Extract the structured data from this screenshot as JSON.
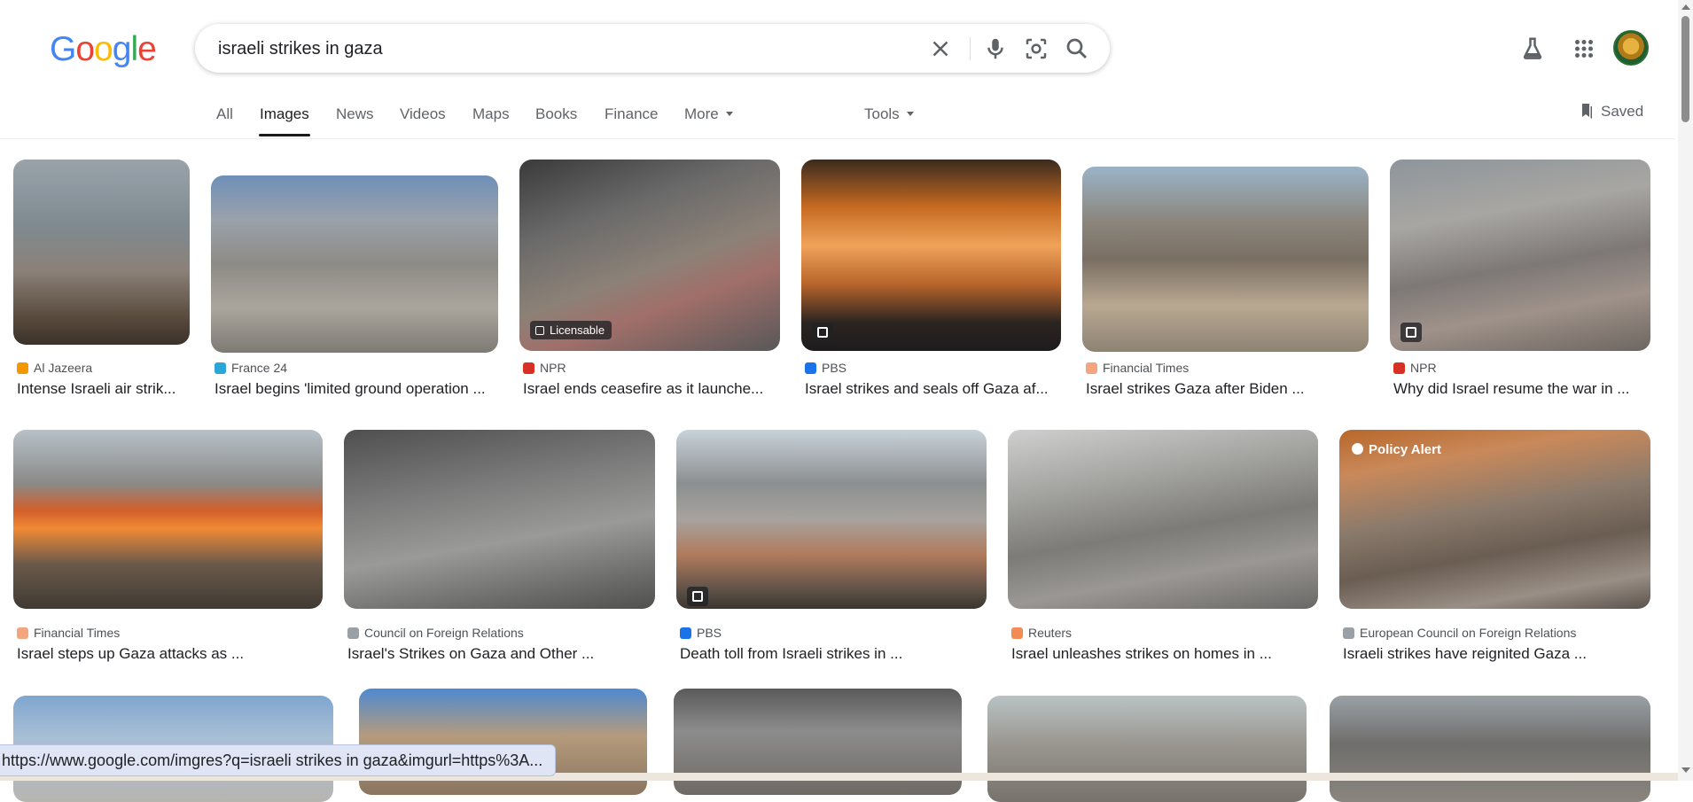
{
  "logo": {
    "letters": [
      "G",
      "o",
      "o",
      "g",
      "l",
      "e"
    ],
    "colors": [
      "#4285F4",
      "#EA4335",
      "#FBBC05",
      "#4285F4",
      "#34A853",
      "#EA4335"
    ]
  },
  "search": {
    "query": "israeli strikes in gaza",
    "placeholder": ""
  },
  "icons": {
    "clear": "close-icon",
    "voice": "mic-icon",
    "lens": "camera-lens-icon",
    "search": "search-icon",
    "labs": "flask-icon",
    "apps": "apps-grid-icon"
  },
  "tabs": [
    {
      "label": "All"
    },
    {
      "label": "Images"
    },
    {
      "label": "News"
    },
    {
      "label": "Videos"
    },
    {
      "label": "Maps"
    },
    {
      "label": "Books"
    },
    {
      "label": "Finance"
    },
    {
      "label": "More"
    }
  ],
  "tools_label": "Tools",
  "saved_label": "Saved",
  "results": {
    "row1": [
      {
        "source": "Al Jazeera",
        "title": "Intense Israeli air strik...",
        "fav": "#f29900",
        "badge": ""
      },
      {
        "source": "France 24",
        "title": "Israel begins 'limited ground operation ...",
        "fav": "#2aa6d9",
        "badge": ""
      },
      {
        "source": "NPR",
        "title": "Israel ends ceasefire as it launche...",
        "fav": "#d93025",
        "badge": "Licensable"
      },
      {
        "source": "PBS",
        "title": "Israel strikes and seals off Gaza af...",
        "fav": "#1a73e8",
        "badge": ""
      },
      {
        "source": "Financial Times",
        "title": "Israel strikes Gaza after Biden ...",
        "fav": "#f2a57e",
        "badge": ""
      },
      {
        "source": "NPR",
        "title": "Why did Israel resume the war in ...",
        "fav": "#d93025",
        "badge": ""
      }
    ],
    "row2": [
      {
        "source": "Financial Times",
        "title": "Israel steps up Gaza attacks as ...",
        "fav": "#f2a57e"
      },
      {
        "source": "Council on Foreign Relations",
        "title": "Israel's Strikes on Gaza and Other ...",
        "fav": "#9aa0a6"
      },
      {
        "source": "PBS",
        "title": "Death toll from Israeli strikes in ...",
        "fav": "#1a73e8"
      },
      {
        "source": "Reuters",
        "title": "Israel unleashes strikes on homes in ...",
        "fav": "#f28b54"
      },
      {
        "source": "European Council on Foreign Relations",
        "title": "Israeli strikes have reignited Gaza ...",
        "fav": "#9aa0a6",
        "overlay": "Policy Alert"
      }
    ]
  },
  "status_url": "https://www.google.com/imgres?q=israeli strikes in gaza&imgurl=https%3A..."
}
